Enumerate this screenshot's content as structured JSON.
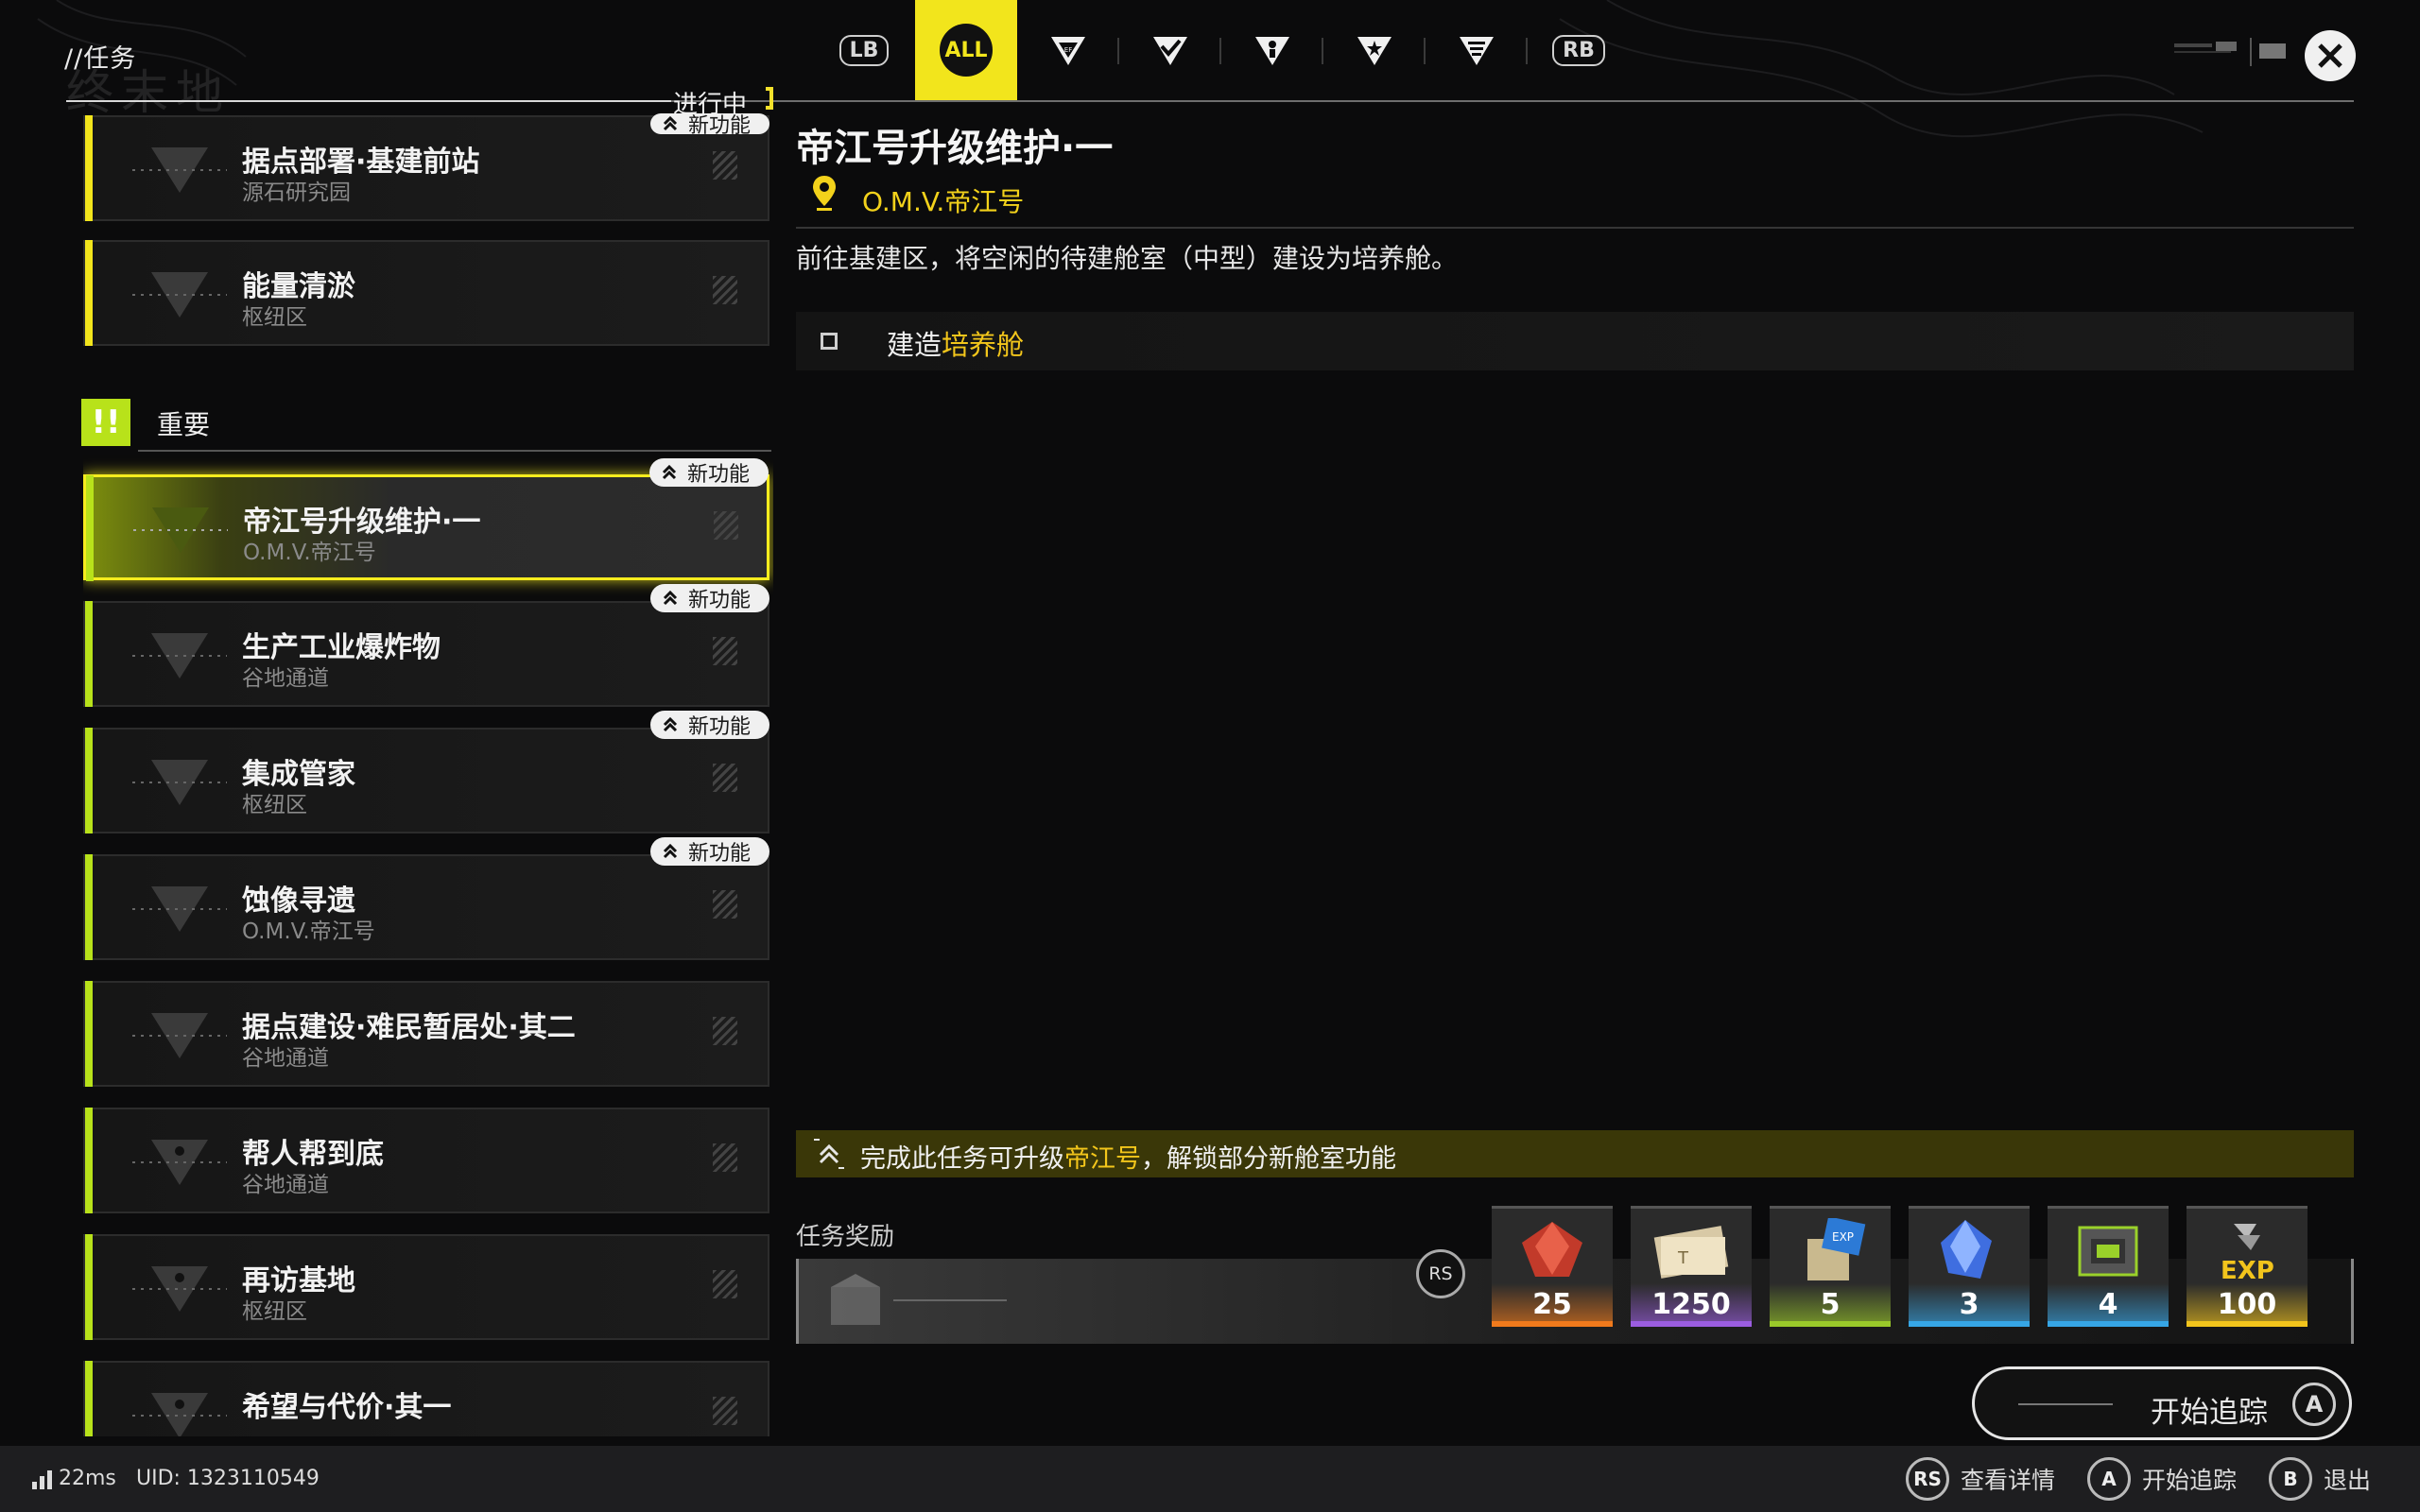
{
  "header": {
    "title": "//任务",
    "logo_text": "终末地",
    "status_label": "进行中"
  },
  "tabs": [
    {
      "id": "lb",
      "label": "LB",
      "icon": "lb-bumper"
    },
    {
      "id": "all",
      "label": "ALL",
      "icon": "all-filter",
      "active": true
    },
    {
      "id": "t1",
      "icon": "endfield-triangle-icon"
    },
    {
      "id": "t2",
      "icon": "check-triangle-icon"
    },
    {
      "id": "t3",
      "icon": "person-triangle-icon"
    },
    {
      "id": "t4",
      "icon": "star-triangle-icon"
    },
    {
      "id": "t5",
      "icon": "stack-triangle-icon"
    },
    {
      "id": "rb",
      "label": "RB",
      "icon": "rb-bumper"
    }
  ],
  "quests_in_progress": [
    {
      "name": "据点部署·基建前站",
      "location": "源石研究园",
      "badge": "新功能"
    },
    {
      "name": "能量清淤",
      "location": "枢纽区"
    }
  ],
  "important_section": {
    "label": "重要",
    "icon": "exclamation-icon"
  },
  "quests_important": [
    {
      "name": "帝江号升级维护·一",
      "location": "O.M.V.帝江号",
      "badge": "新功能",
      "selected": true
    },
    {
      "name": "生产工业爆炸物",
      "location": "谷地通道",
      "badge": "新功能"
    },
    {
      "name": "集成管家",
      "location": "枢纽区",
      "badge": "新功能"
    },
    {
      "name": "蚀像寻遗",
      "location": "O.M.V.帝江号",
      "badge": "新功能"
    },
    {
      "name": "据点建设·难民暂居处·其二",
      "location": "谷地通道"
    },
    {
      "name": "帮人帮到底",
      "location": "谷地通道"
    },
    {
      "name": "再访基地",
      "location": "枢纽区"
    },
    {
      "name": "希望与代价·其一",
      "location": ""
    }
  ],
  "detail": {
    "title": "帝江号升级维护·一",
    "location": "O.M.V.帝江号",
    "description": "前往基建区，将空闲的待建舱室（中型）建设为培养舱。",
    "objective_prefix": "建造",
    "objective_highlight": "培养舱",
    "unlock_prefix": "完成此任务可升级",
    "unlock_highlight": "帝江号",
    "unlock_suffix": "，解锁部分新舱室功能",
    "rewards_label": "任务奖励",
    "rs_label": "RS",
    "rewards": [
      {
        "icon": "red-crystal-icon",
        "count": "25",
        "color": "#f07a1c"
      },
      {
        "icon": "ticket-bundle-icon",
        "count": "1250",
        "color": "#9b5de0"
      },
      {
        "icon": "exp-card-icon",
        "count": "5",
        "color": "#9ac92a"
      },
      {
        "icon": "blue-crystal-icon",
        "count": "3",
        "color": "#36a6e6"
      },
      {
        "icon": "module-chip-icon",
        "count": "4",
        "color": "#36a6e6"
      },
      {
        "icon": "exp-badge-icon",
        "count": "100",
        "color": "#f2c41c"
      }
    ],
    "track_button": "开始追踪",
    "track_key": "A"
  },
  "footer": {
    "ping": "22ms",
    "uid": "UID: 1323110549",
    "hints": [
      {
        "key": "RS",
        "label": "查看详情"
      },
      {
        "key": "A",
        "label": "开始追踪"
      },
      {
        "key": "B",
        "label": "退出"
      }
    ]
  },
  "colors": {
    "accent_yellow": "#f2e51c",
    "accent_green": "#b8e21a",
    "highlight_text": "#f3c61b"
  }
}
